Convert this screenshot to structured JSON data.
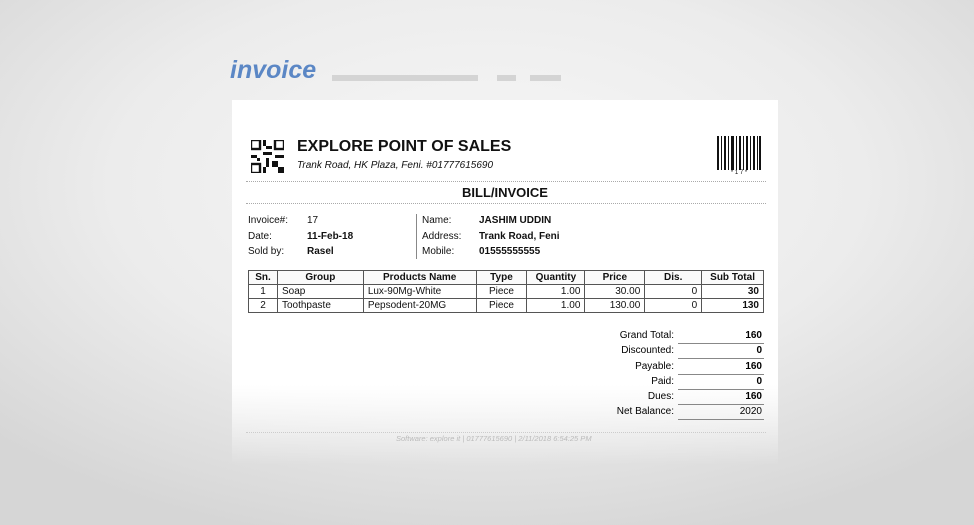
{
  "page_title": "invoice",
  "company": {
    "name": "EXPLORE POINT OF SALES",
    "address": "Trank Road, HK Plaza, Feni. #01777615690",
    "barcode_text": "* 1 7 *"
  },
  "doc_title": "BILL/INVOICE",
  "info": {
    "invoice_label": "Invoice#:",
    "invoice_value": "17",
    "date_label": "Date:",
    "date_value": "11-Feb-18",
    "soldby_label": "Sold by:",
    "soldby_value": "Rasel",
    "name_label": "Name:",
    "name_value": "JASHIM UDDIN",
    "address_label": "Address:",
    "address_value": "Trank Road, Feni",
    "mobile_label": "Mobile:",
    "mobile_value": "01555555555"
  },
  "table": {
    "headers": [
      "Sn.",
      "Group",
      "Products Name",
      "Type",
      "Quantity",
      "Price",
      "Dis.",
      "Sub Total"
    ],
    "rows": [
      [
        "1",
        "Soap",
        "Lux-90Mg-White",
        "Piece",
        "1.00",
        "30.00",
        "0",
        "30"
      ],
      [
        "2",
        "Toothpaste",
        "Pepsodent-20MG",
        "Piece",
        "1.00",
        "130.00",
        "0",
        "130"
      ]
    ]
  },
  "summary": [
    {
      "label": "Grand Total:",
      "value": "160"
    },
    {
      "label": "Discounted:",
      "value": "0"
    },
    {
      "label": "Payable:",
      "value": "160"
    },
    {
      "label": "Paid:",
      "value": "0"
    },
    {
      "label": "Dues:",
      "value": "160"
    },
    {
      "label": "Net Balance:",
      "value": "2020"
    }
  ],
  "footer": "Software: explore it | 01777615690  | 2/11/2018 6:54:25 PM",
  "colors": {
    "title": "#5b87c5"
  }
}
